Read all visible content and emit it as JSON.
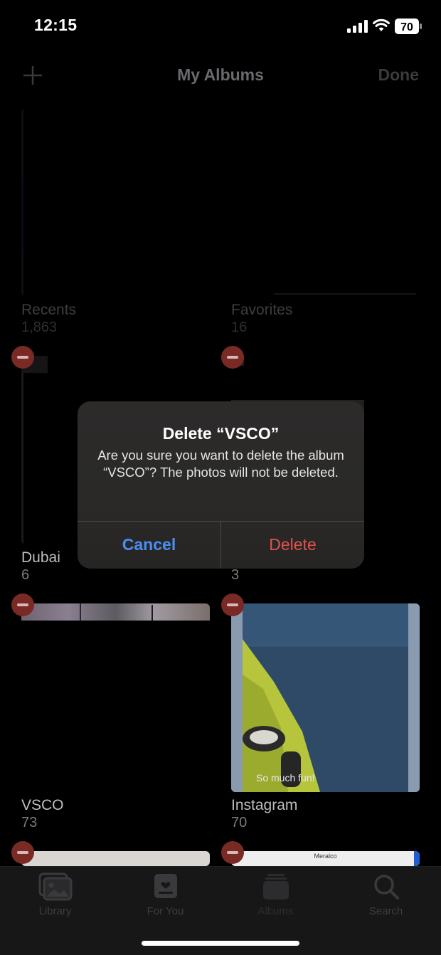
{
  "status": {
    "time": "12:15",
    "battery": "70"
  },
  "nav": {
    "title": "My Albums",
    "done_label": "Done"
  },
  "albums": [
    {
      "name": "Recents",
      "count": "1,863"
    },
    {
      "name": "Favorites",
      "count": "16"
    },
    {
      "name": "Dubai",
      "count": "6"
    },
    {
      "name": "",
      "count": "3"
    },
    {
      "name": "VSCO",
      "count": "73"
    },
    {
      "name": "Instagram",
      "count": "70"
    }
  ],
  "thumb_text": {
    "instagram_caption": "So much fun!",
    "receipt_header": "Meralco"
  },
  "alert": {
    "title": "Delete “VSCO”",
    "message": "Are you sure you want to delete the album “VSCO”? The photos will not be deleted.",
    "cancel_label": "Cancel",
    "delete_label": "Delete"
  },
  "tabs": [
    {
      "label": "Library",
      "icon": "photo-library-icon"
    },
    {
      "label": "For You",
      "icon": "for-you-icon"
    },
    {
      "label": "Albums",
      "icon": "albums-icon"
    },
    {
      "label": "Search",
      "icon": "search-icon"
    }
  ],
  "colors": {
    "accent": "#4b8ef0",
    "destructive": "#e0524c",
    "remove": "#7a2a25"
  }
}
